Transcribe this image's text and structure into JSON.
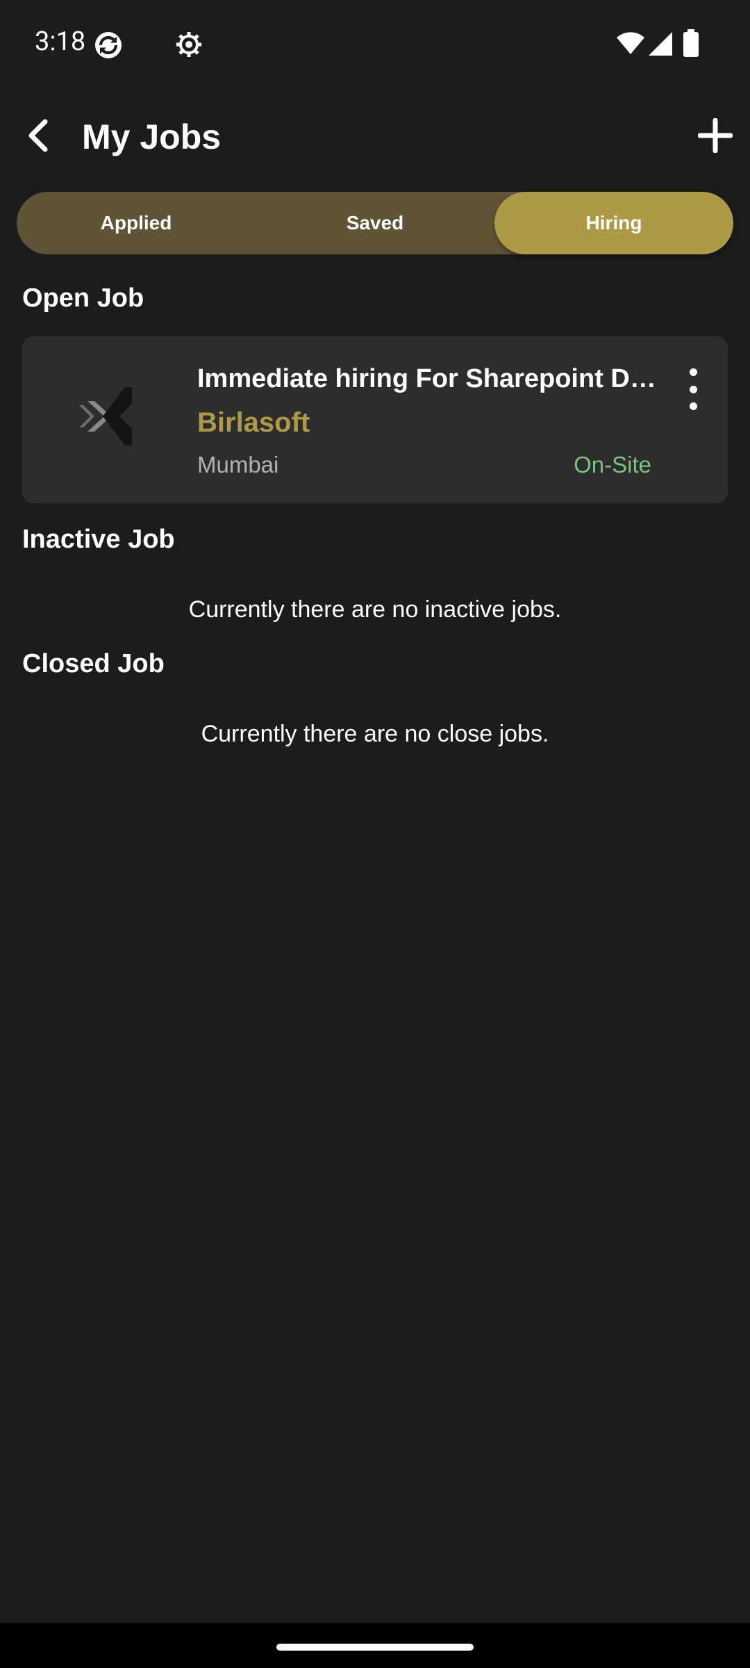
{
  "status_bar": {
    "time": "3:18",
    "icons": [
      "sync-icon",
      "settings-gear-icon",
      "wifi-icon",
      "signal-icon",
      "battery-icon"
    ]
  },
  "app_bar": {
    "title": "My Jobs",
    "back_icon": "back-arrow-icon",
    "add_icon": "plus-icon"
  },
  "tabs": [
    {
      "label": "Applied",
      "selected": false
    },
    {
      "label": "Saved",
      "selected": false
    },
    {
      "label": "Hiring",
      "selected": true
    }
  ],
  "sections": {
    "open": {
      "title": "Open Job",
      "jobs": [
        {
          "title": "Immediate hiring For Sharepoint Developer",
          "company": "Birlasoft",
          "location": "Mumbai",
          "mode": "On-Site",
          "logo_icon": "birlasoft-logo-icon"
        }
      ]
    },
    "inactive": {
      "title": "Inactive Job",
      "empty_message": "Currently there are no inactive jobs."
    },
    "closed": {
      "title": "Closed Job",
      "empty_message": "Currently there are no close jobs."
    }
  },
  "colors": {
    "background": "#1b1c1c",
    "accent": "#ad9a45",
    "tab_track": "#5f5436",
    "card": "#2d2d2d",
    "on_site": "#79c57a"
  }
}
